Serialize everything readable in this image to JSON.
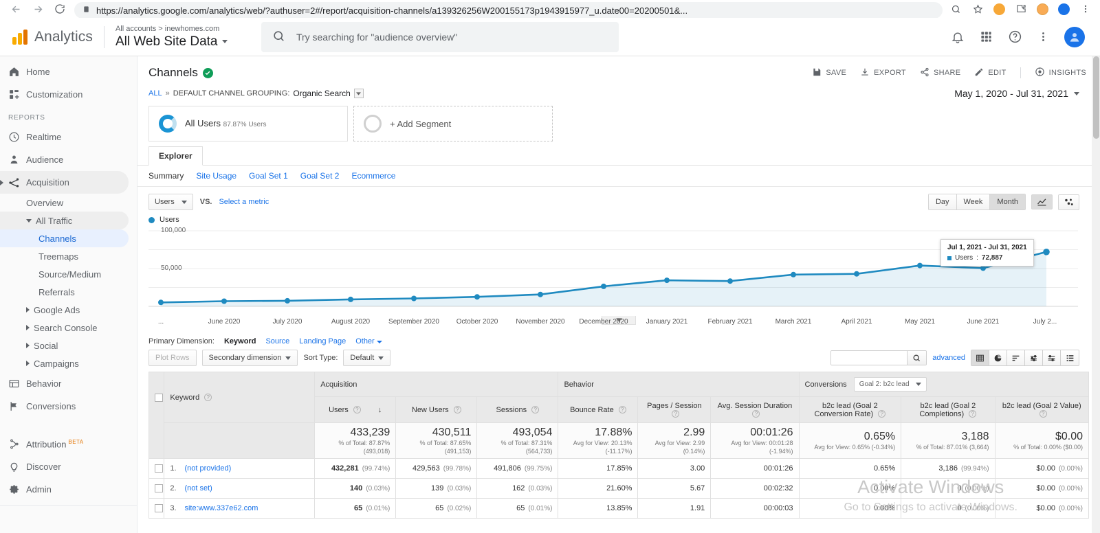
{
  "browser": {
    "url": "https://analytics.google.com/analytics/web/?authuser=2#/report/acquisition-channels/a139326256W200155173p1943915977_u.date00=20200501&...",
    "back_icon": "back-arrow-icon",
    "forward_icon": "forward-arrow-icon",
    "reload_icon": "reload-icon",
    "lock_icon": "site-info-icon",
    "zoom_icon": "search-page-icon",
    "star_icon": "bookmark-star-icon",
    "extensions_icon": "puzzle-piece-icon",
    "menu_icon": "chrome-menu-icon"
  },
  "header": {
    "product": "Analytics",
    "account_breadcrumb": "All accounts > inewhomes.com",
    "property_view": "All Web Site Data",
    "search_placeholder": "Try searching for \"audience overview\"",
    "notifications_icon": "bell-icon",
    "apps_icon": "apps-grid-icon",
    "help_icon": "help-circle-icon",
    "more_icon": "vertical-dots-icon",
    "avatar_icon": "user-avatar"
  },
  "sidebar": {
    "section_label": "REPORTS",
    "top_items": [
      {
        "label": "Home",
        "icon": "home-icon"
      },
      {
        "label": "Customization",
        "icon": "customization-icon"
      }
    ],
    "report_items": [
      {
        "label": "Realtime",
        "icon": "clock-icon"
      },
      {
        "label": "Audience",
        "icon": "person-icon"
      },
      {
        "label": "Acquisition",
        "icon": "acquisition-icon"
      }
    ],
    "acquisition_children": [
      {
        "label": "Overview",
        "level": 1
      },
      {
        "label": "All Traffic",
        "level": 1,
        "expanded": true
      },
      {
        "label": "Channels",
        "level": 2,
        "active": true
      },
      {
        "label": "Treemaps",
        "level": 2
      },
      {
        "label": "Source/Medium",
        "level": 2
      },
      {
        "label": "Referrals",
        "level": 2
      },
      {
        "label": "Google Ads",
        "level": 1,
        "collapsed": true
      },
      {
        "label": "Search Console",
        "level": 1,
        "collapsed": true
      },
      {
        "label": "Social",
        "level": 1,
        "collapsed": true
      },
      {
        "label": "Campaigns",
        "level": 1,
        "collapsed": true
      }
    ],
    "bottom_reports": [
      {
        "label": "Behavior",
        "icon": "behavior-icon"
      },
      {
        "label": "Conversions",
        "icon": "flag-icon"
      }
    ],
    "footer_items": [
      {
        "label": "Attribution",
        "icon": "attribution-icon",
        "badge": "BETA"
      },
      {
        "label": "Discover",
        "icon": "lightbulb-icon"
      },
      {
        "label": "Admin",
        "icon": "gear-icon"
      }
    ]
  },
  "report": {
    "title": "Channels",
    "verified_icon": "verified-check-icon",
    "actions": [
      {
        "label": "SAVE",
        "icon": "save-icon"
      },
      {
        "label": "EXPORT",
        "icon": "export-icon"
      },
      {
        "label": "SHARE",
        "icon": "share-icon"
      },
      {
        "label": "EDIT",
        "icon": "edit-pencil-icon"
      },
      {
        "label": "INSIGHTS",
        "icon": "insights-icon"
      }
    ],
    "breadcrumb": {
      "all": "ALL",
      "separator": "»",
      "dimension_label": "DEFAULT CHANNEL GROUPING:",
      "dimension_value": "Organic Search"
    },
    "date_range": "May 1, 2020 - Jul 31, 2021"
  },
  "segments": [
    {
      "name": "All Users",
      "sub": "87.87% Users",
      "type": "applied"
    },
    {
      "name": "+ Add Segment",
      "type": "add"
    }
  ],
  "tabs": {
    "explorer": "Explorer",
    "subtabs": [
      {
        "label": "Summary",
        "active": true
      },
      {
        "label": "Site Usage",
        "active": false
      },
      {
        "label": "Goal Set 1",
        "active": false
      },
      {
        "label": "Goal Set 2",
        "active": false
      },
      {
        "label": "Ecommerce",
        "active": false
      }
    ]
  },
  "chart_controls": {
    "metric_select": "Users",
    "vs_label": "VS.",
    "select_metric": "Select a metric",
    "granularity": [
      {
        "label": "Day",
        "active": false
      },
      {
        "label": "Week",
        "active": false
      },
      {
        "label": "Month",
        "active": true
      }
    ],
    "chart_type_icon": "line-chart-icon",
    "scatter_icon": "scatter-plot-icon",
    "legend_label": "Users"
  },
  "chart_data": {
    "type": "line",
    "title": "Users",
    "xlabel": "",
    "ylabel": "Users",
    "ylim": [
      0,
      125000
    ],
    "yticks": [
      50000,
      100000
    ],
    "ytick_labels": [
      "50,000",
      "100,000"
    ],
    "grid": true,
    "legend": [
      "Users"
    ],
    "legend_position": "top-left",
    "series_color": "#1f8ac0",
    "categories": [
      "...",
      "June 2020",
      "July 2020",
      "August 2020",
      "September 2020",
      "October 2020",
      "November 2020",
      "December 2020",
      "January 2021",
      "February 2021",
      "March 2021",
      "April 2021",
      "May 2021",
      "June 2021",
      "July 2..."
    ],
    "values": [
      5200,
      6800,
      7400,
      9200,
      10500,
      12600,
      15800,
      26500,
      34500,
      33500,
      42000,
      43000,
      54000,
      50500,
      72887
    ],
    "annotation": {
      "title": "Jul 1, 2021 - Jul 31, 2021",
      "series": "Users",
      "value": "72,887"
    }
  },
  "primary_dimension": {
    "label": "Primary Dimension:",
    "active": "Keyword",
    "options": [
      "Source",
      "Landing Page"
    ],
    "other": "Other"
  },
  "table_controls": {
    "plot_rows": "Plot Rows",
    "secondary_dimension": "Secondary dimension",
    "sort_type_label": "Sort Type:",
    "sort_type_value": "Default",
    "search_value": "",
    "advanced": "advanced",
    "view_icons": [
      "table-view-icon",
      "pie-chart-view-icon",
      "performance-view-icon",
      "comparison-view-icon",
      "pivot-view-icon",
      "term-cloud-icon"
    ]
  },
  "table": {
    "group_headers": [
      {
        "label": "Acquisition",
        "span": 3
      },
      {
        "label": "Behavior",
        "span": 3
      },
      {
        "label": "Conversions",
        "span": 3,
        "selector": "Goal 2: b2c lead"
      }
    ],
    "dimension_header": "Keyword",
    "columns": [
      {
        "label": "Users",
        "sorted": true,
        "sort_dir": "desc"
      },
      {
        "label": "New Users"
      },
      {
        "label": "Sessions"
      },
      {
        "label": "Bounce Rate"
      },
      {
        "label": "Pages / Session"
      },
      {
        "label": "Avg. Session Duration"
      },
      {
        "label": "b2c lead (Goal 2 Conversion Rate)"
      },
      {
        "label": "b2c lead (Goal 2 Completions)"
      },
      {
        "label": "b2c lead (Goal 2 Value)"
      }
    ],
    "totals": [
      {
        "value": "433,239",
        "sub": "% of Total: 87.87% (493,018)"
      },
      {
        "value": "430,511",
        "sub": "% of Total: 87.65% (491,153)"
      },
      {
        "value": "493,054",
        "sub": "% of Total: 87.31% (564,733)"
      },
      {
        "value": "17.88%",
        "sub": "Avg for View: 20.13% (-11.17%)"
      },
      {
        "value": "2.99",
        "sub": "Avg for View: 2.99 (0.14%)"
      },
      {
        "value": "00:01:26",
        "sub": "Avg for View: 00:01:28 (-1.94%)"
      },
      {
        "value": "0.65%",
        "sub": "Avg for View: 0.65% (-0.34%)"
      },
      {
        "value": "3,188",
        "sub": "% of Total: 87.01% (3,664)"
      },
      {
        "value": "$0.00",
        "sub": "% of Total: 0.00% ($0.00)"
      }
    ],
    "rows": [
      {
        "index": "1.",
        "keyword": "(not provided)",
        "cells": [
          {
            "value": "432,281",
            "pct": "(99.74%)",
            "bold": true
          },
          {
            "value": "429,563",
            "pct": "(99.78%)"
          },
          {
            "value": "491,806",
            "pct": "(99.75%)"
          },
          {
            "value": "17.85%"
          },
          {
            "value": "3.00"
          },
          {
            "value": "00:01:26"
          },
          {
            "value": "0.65%"
          },
          {
            "value": "3,186",
            "pct": "(99.94%)"
          },
          {
            "value": "$0.00",
            "pct": "(0.00%)"
          }
        ]
      },
      {
        "index": "2.",
        "keyword": "(not set)",
        "cells": [
          {
            "value": "140",
            "pct": "(0.03%)",
            "bold": true
          },
          {
            "value": "139",
            "pct": "(0.03%)"
          },
          {
            "value": "162",
            "pct": "(0.03%)"
          },
          {
            "value": "21.60%"
          },
          {
            "value": "5.67"
          },
          {
            "value": "00:02:32"
          },
          {
            "value": "0.00%"
          },
          {
            "value": "0",
            "pct": "(0.00%)"
          },
          {
            "value": "$0.00",
            "pct": "(0.00%)"
          }
        ]
      },
      {
        "index": "3.",
        "keyword": "site:www.337e62.com",
        "cells": [
          {
            "value": "65",
            "pct": "(0.01%)",
            "bold": true
          },
          {
            "value": "65",
            "pct": "(0.02%)"
          },
          {
            "value": "65",
            "pct": "(0.01%)"
          },
          {
            "value": "13.85%"
          },
          {
            "value": "1.91"
          },
          {
            "value": "00:00:03"
          },
          {
            "value": "0.00%"
          },
          {
            "value": "0",
            "pct": "(0.00%)"
          },
          {
            "value": "$0.00",
            "pct": "(0.00%)"
          }
        ]
      }
    ]
  },
  "watermark": {
    "line1": "Activate Windows",
    "line2": "Go to Settings to activate Windows."
  }
}
